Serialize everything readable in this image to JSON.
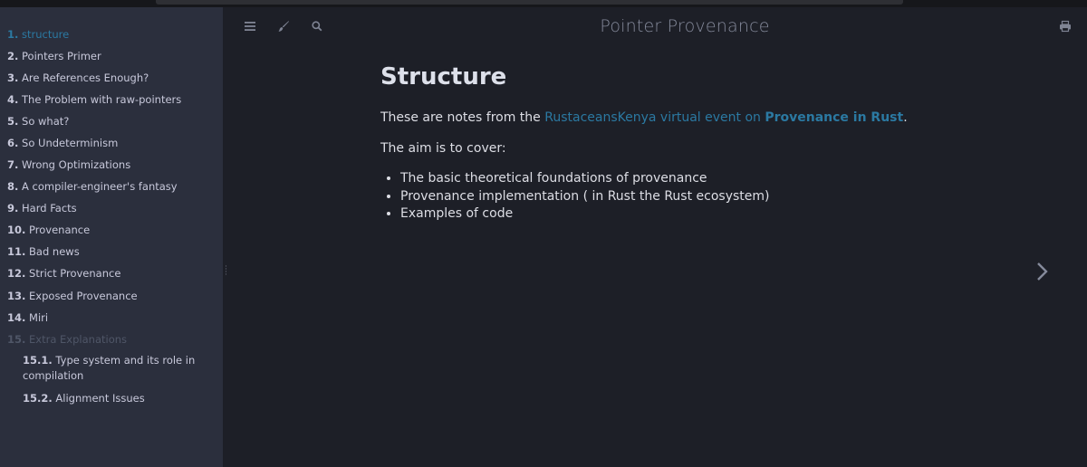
{
  "window": {
    "title": "Pointer Provenance"
  },
  "toolbar": {
    "icons": [
      "menu-icon",
      "paintbrush-icon",
      "search-icon",
      "print-icon"
    ]
  },
  "sidebar": {
    "chapters": [
      {
        "num": "1.",
        "label": "structure",
        "state": "active"
      },
      {
        "num": "2.",
        "label": "Pointers Primer",
        "state": "normal"
      },
      {
        "num": "3.",
        "label": "Are References Enough?",
        "state": "normal"
      },
      {
        "num": "4.",
        "label": "The Problem with raw-pointers",
        "state": "normal"
      },
      {
        "num": "5.",
        "label": "So what?",
        "state": "normal"
      },
      {
        "num": "6.",
        "label": "So Undeterminism",
        "state": "normal"
      },
      {
        "num": "7.",
        "label": "Wrong Optimizations",
        "state": "normal"
      },
      {
        "num": "8.",
        "label": "A compiler-engineer's fantasy",
        "state": "normal"
      },
      {
        "num": "9.",
        "label": "Hard Facts",
        "state": "normal"
      },
      {
        "num": "10.",
        "label": "Provenance",
        "state": "normal"
      },
      {
        "num": "11.",
        "label": "Bad news",
        "state": "normal"
      },
      {
        "num": "12.",
        "label": "Strict Provenance",
        "state": "normal"
      },
      {
        "num": "13.",
        "label": "Exposed Provenance",
        "state": "normal"
      },
      {
        "num": "14.",
        "label": "Miri",
        "state": "normal"
      },
      {
        "num": "15.",
        "label": "Extra Explanations",
        "state": "draft"
      },
      {
        "num": "15.1.",
        "label": "Type system and its role in compilation",
        "state": "sub"
      },
      {
        "num": "15.2.",
        "label": "Alignment Issues",
        "state": "sub"
      }
    ]
  },
  "content": {
    "heading": "Structure",
    "intro_prefix": "These are notes from the ",
    "intro_link": "RustaceansKenya virtual event on ",
    "intro_link_bold": "Provenance in Rust",
    "intro_suffix": ".",
    "aim": "The aim is to cover:",
    "bullets": [
      "The basic theoretical foundations of provenance",
      "Provenance implementation ( in Rust the Rust ecosystem)",
      "Examples of code"
    ]
  },
  "colors": {
    "sidebar_bg": "#2b2f3d",
    "content_bg": "#1d1f27",
    "link": "#2b79a2",
    "text": "#dddee5"
  }
}
